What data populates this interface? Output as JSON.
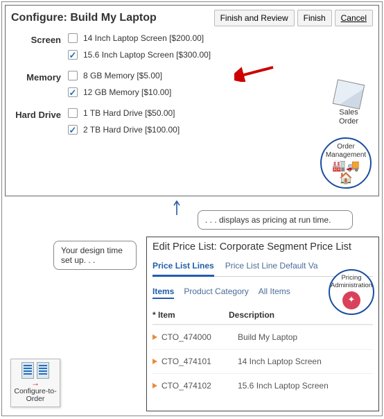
{
  "configure": {
    "title": "Configure: Build My Laptop",
    "buttons": {
      "finish_review": "Finish and Review",
      "finish": "Finish",
      "cancel": "Cancel"
    },
    "groups": [
      {
        "label": "Screen",
        "options": [
          {
            "label": "14 Inch Laptop Screen [$200.00]",
            "checked": false
          },
          {
            "label": "15.6 Inch Laptop Screen [$300.00]",
            "checked": true
          }
        ]
      },
      {
        "label": "Memory",
        "options": [
          {
            "label": "8 GB Memory [$5.00]",
            "checked": false
          },
          {
            "label": "12 GB Memory [$10.00]",
            "checked": true
          }
        ]
      },
      {
        "label": "Hard Drive",
        "options": [
          {
            "label": "1 TB Hard Drive [$50.00]",
            "checked": false
          },
          {
            "label": "2 TB Hard Drive [$100.00]",
            "checked": true
          }
        ]
      }
    ]
  },
  "sales_order_label": "Sales Order",
  "om_label": "Order Management",
  "callouts": {
    "design_time": "Your design time set up. . .",
    "runtime": ". . . displays as pricing at run time."
  },
  "price_panel": {
    "title": "Edit Price List: Corporate Segment Price List",
    "tabs": [
      {
        "label": "Price List Lines",
        "active": true
      },
      {
        "label": "Price List Line Default Va",
        "active": false
      }
    ],
    "subtabs": [
      {
        "label": "Items",
        "active": true
      },
      {
        "label": "Product Category",
        "active": false
      },
      {
        "label": "All Items",
        "active": false
      }
    ],
    "columns": {
      "item": "* Item",
      "desc": "Description"
    },
    "rows": [
      {
        "item": "CTO_474000",
        "desc": "Build My Laptop"
      },
      {
        "item": "CTO_474101",
        "desc": "14 Inch Laptop Screen"
      },
      {
        "item": "CTO_474102",
        "desc": "15.6 Inch Laptop Screen"
      }
    ]
  },
  "pa_label": "Pricing Administration",
  "cto_label": "Configure-to-Order"
}
